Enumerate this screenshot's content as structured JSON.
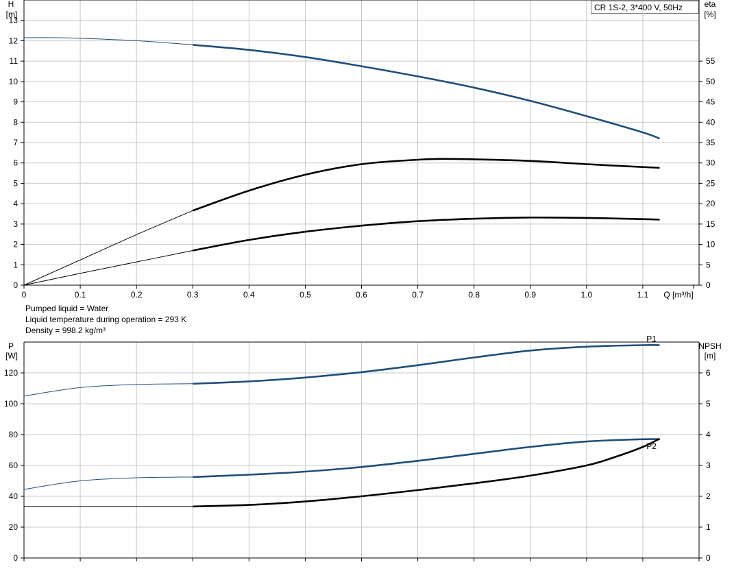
{
  "legend": "CR 1S-2, 3*400 V, 50Hz",
  "info": [
    "Pumped liquid = Water",
    "Liquid temperature during operation = 293 K",
    "Density = 998.2 kg/m³"
  ],
  "colors": {
    "blue": "#1f4e79",
    "black": "#000000",
    "grid": "#c8c8c8"
  },
  "chart_data": [
    {
      "type": "line",
      "xlabel": "Q [m³/h]",
      "ylabel_left": [
        "H",
        "[m]"
      ],
      "ylabel_right": [
        "eta",
        "[%]"
      ],
      "xlim": [
        0,
        1.2
      ],
      "ylim_left": [
        0,
        14
      ],
      "ylim_right": [
        0,
        70
      ],
      "x_ticks": [
        "0",
        "0.1",
        "0.2",
        "0.3",
        "0.4",
        "0.5",
        "0.6",
        "0.7",
        "0.8",
        "0.9",
        "1.0",
        "1.1"
      ],
      "y_ticks_left": [
        "0",
        "1",
        "2",
        "3",
        "4",
        "5",
        "6",
        "7",
        "8",
        "9",
        "10",
        "11",
        "12",
        "13"
      ],
      "y_ticks_right": [
        "0",
        "5",
        "10",
        "15",
        "20",
        "25",
        "30",
        "35",
        "40",
        "45",
        "50",
        "55"
      ],
      "grid": true,
      "series": [
        {
          "axis": "left",
          "color": "blue",
          "operating_range": [
            0.3,
            1.13
          ],
          "x": [
            0,
            0.05,
            0.1,
            0.2,
            0.3,
            0.4,
            0.5,
            0.6,
            0.7,
            0.8,
            0.9,
            1.0,
            1.1,
            1.13
          ],
          "y": [
            12.15,
            12.15,
            12.12,
            12.0,
            11.8,
            11.55,
            11.2,
            10.75,
            10.25,
            9.7,
            9.05,
            8.3,
            7.5,
            7.2
          ]
        },
        {
          "axis": "right",
          "color": "black",
          "operating_range": [
            0.3,
            1.13
          ],
          "x": [
            0,
            0.1,
            0.2,
            0.3,
            0.4,
            0.5,
            0.6,
            0.7,
            0.75,
            0.8,
            0.9,
            1.0,
            1.1,
            1.13
          ],
          "y": [
            0,
            6.2,
            12.4,
            18.3,
            23.2,
            27.1,
            29.7,
            30.8,
            31.0,
            30.9,
            30.5,
            29.7,
            29.0,
            28.8
          ]
        },
        {
          "axis": "right",
          "color": "black",
          "operating_range": [
            0.3,
            1.13
          ],
          "x": [
            0,
            0.1,
            0.2,
            0.3,
            0.4,
            0.5,
            0.6,
            0.7,
            0.8,
            0.9,
            1.0,
            1.1,
            1.13
          ],
          "y": [
            0,
            2.9,
            5.7,
            8.5,
            11.1,
            13.1,
            14.6,
            15.7,
            16.3,
            16.6,
            16.5,
            16.2,
            16.1
          ]
        }
      ]
    },
    {
      "type": "line",
      "ylabel_left": [
        "P",
        "[W]"
      ],
      "ylabel_right": [
        "NPSH",
        "[m]"
      ],
      "xlim": [
        0,
        1.2
      ],
      "ylim_left": [
        0,
        140
      ],
      "ylim_right": [
        0,
        7
      ],
      "y_ticks_left": [
        "0",
        "20",
        "40",
        "60",
        "80",
        "100",
        "120"
      ],
      "y_ticks_right": [
        "0",
        "1",
        "2",
        "3",
        "4",
        "5",
        "6"
      ],
      "grid": true,
      "series": [
        {
          "name": "P1",
          "axis": "left",
          "color": "blue",
          "operating_range": [
            0.3,
            1.13
          ],
          "x": [
            0,
            0.1,
            0.2,
            0.3,
            0.4,
            0.5,
            0.6,
            0.7,
            0.8,
            0.9,
            1.0,
            1.1,
            1.13
          ],
          "y": [
            105,
            110.5,
            112.5,
            113,
            114.5,
            117,
            120.5,
            125,
            130,
            134.5,
            137,
            138,
            138
          ]
        },
        {
          "name": "P2",
          "axis": "left",
          "color": "blue",
          "operating_range": [
            0.3,
            1.13
          ],
          "x": [
            0,
            0.1,
            0.2,
            0.3,
            0.4,
            0.5,
            0.6,
            0.7,
            0.8,
            0.9,
            1.0,
            1.1,
            1.13
          ],
          "y": [
            44.5,
            50,
            52,
            52.5,
            54,
            56,
            59,
            63,
            67.5,
            72,
            75.5,
            77,
            77
          ]
        },
        {
          "axis": "right",
          "color": "black",
          "operating_range": [
            0.3,
            1.13
          ],
          "x": [
            0,
            0.1,
            0.2,
            0.25,
            0.3,
            0.4,
            0.5,
            0.6,
            0.7,
            0.8,
            0.9,
            1.0,
            1.05,
            1.1,
            1.13
          ],
          "y": [
            1.67,
            1.67,
            1.67,
            1.67,
            1.67,
            1.72,
            1.83,
            2.0,
            2.2,
            2.42,
            2.67,
            3.0,
            3.27,
            3.6,
            3.87
          ]
        }
      ]
    }
  ]
}
